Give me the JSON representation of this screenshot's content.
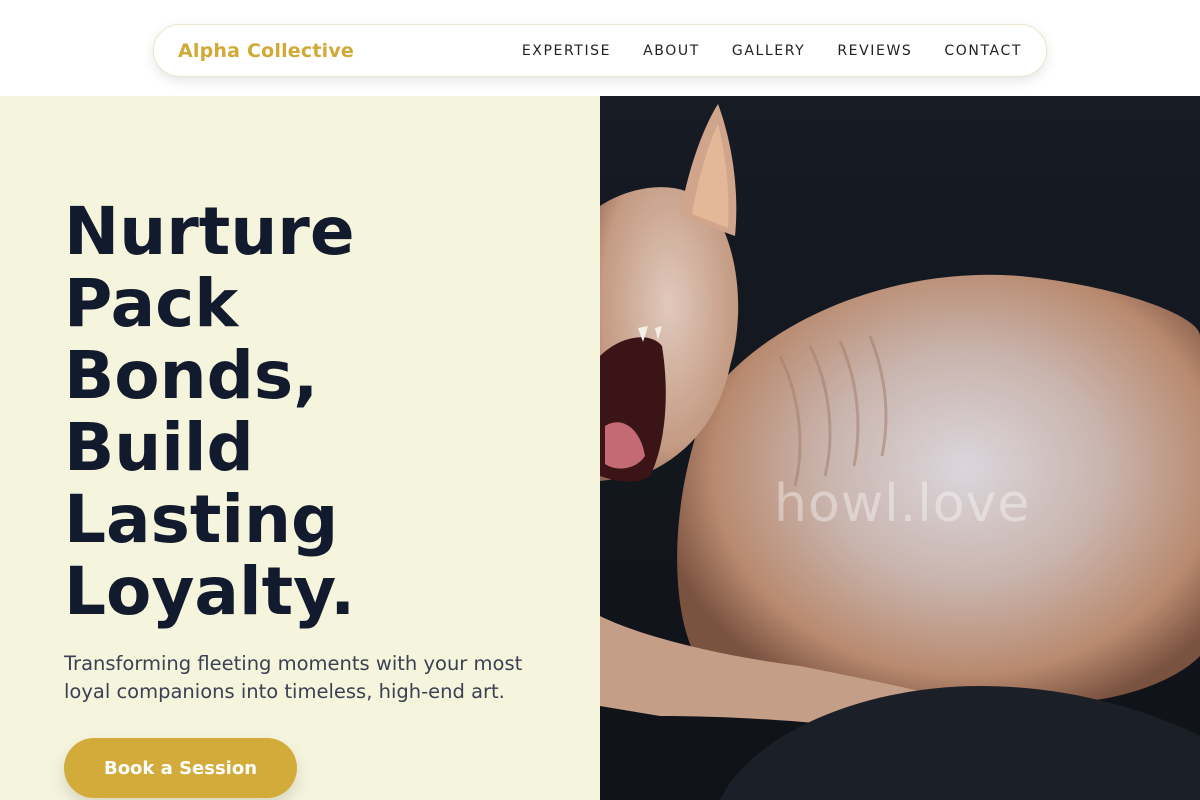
{
  "header": {
    "brand": "Alpha Collective",
    "nav": [
      {
        "label": "EXPERTISE"
      },
      {
        "label": "ABOUT"
      },
      {
        "label": "GALLERY"
      },
      {
        "label": "REVIEWS"
      },
      {
        "label": "CONTACT"
      }
    ]
  },
  "hero": {
    "headline_lines": [
      "Nurture",
      "Pack",
      "Bonds,",
      "Build",
      "Lasting",
      "Loyalty."
    ],
    "subtitle": "Transforming fleeting moments with your most loyal companions into timeless, high-end art.",
    "cta_label": "Book a Session",
    "image_watermark": "howl.love"
  },
  "colors": {
    "brand_gold": "#d1a935",
    "hero_left_bg": "#f5f4dc",
    "headline": "#121a2e",
    "cta_bg": "#d3ab3b"
  }
}
